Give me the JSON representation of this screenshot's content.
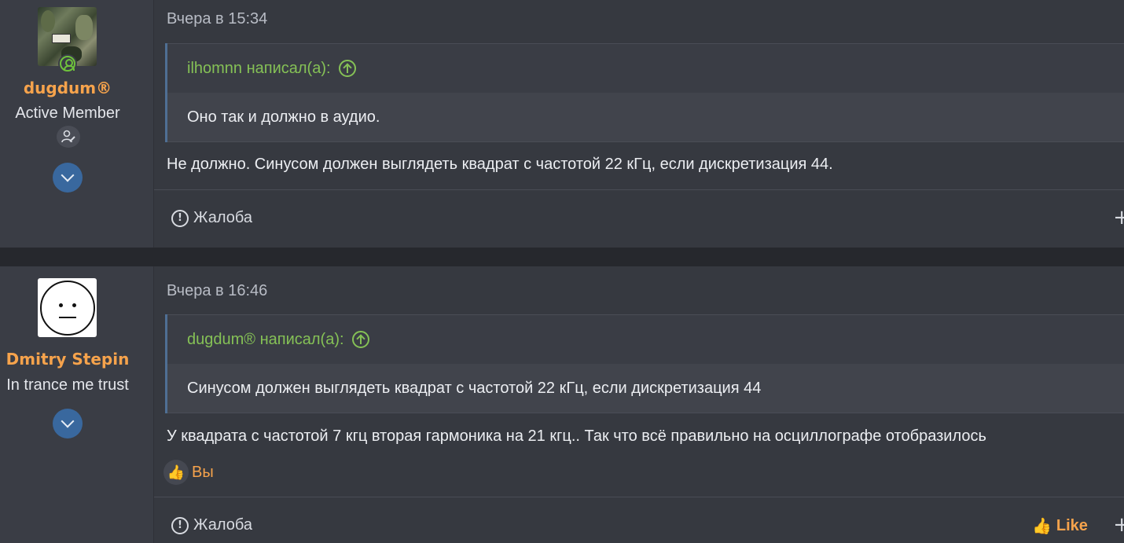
{
  "posts": [
    {
      "username": "dugdum®",
      "user_title": "Active Member",
      "online": true,
      "date": "Вчера в 15:34",
      "quote": {
        "author_line": "ilhomnn написал(а):",
        "text": "Оно так и должно в аудио."
      },
      "message": "Не должно. Синусом должен выглядеть квадрат с частотой 22 кГц, если дискретизация 44.",
      "report_label": "Жалоба",
      "plus": "+"
    },
    {
      "username": "Dmitry Stepin",
      "user_title": "In trance me trust",
      "date": "Вчера в 16:46",
      "quote": {
        "author_line": "dugdum® написал(а):",
        "text": "Синусом должен выглядеть квадрат с частотой 22 кГц, если дискретизация 44"
      },
      "message": "У квадрата с частотой 7 кгц вторая гармоника на 21 кгц.. Так что всё правильно на осциллографе отобразилось",
      "reaction_label": "Вы",
      "report_label": "Жалоба",
      "like_label": "Like",
      "plus": "+"
    }
  ],
  "colors": {
    "username": "#f6a34c",
    "quote_author": "#85c156",
    "online": "#6fc23c",
    "expand_button": "#39689e"
  },
  "icons": {
    "online": "user-circle-icon",
    "banner": "user-edit-icon",
    "expand": "chevron-down-icon",
    "quote_jump": "arrow-up-circle-icon",
    "report": "exclamation-circle-icon",
    "reaction": "thumbs-up-icon",
    "more": "plus-icon"
  }
}
